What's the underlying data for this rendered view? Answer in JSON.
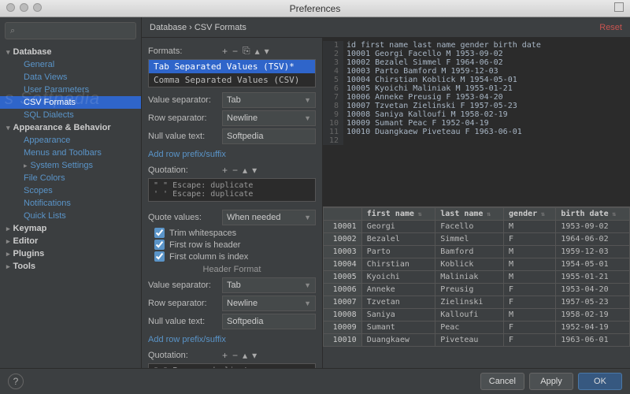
{
  "window": {
    "title": "Preferences"
  },
  "sidebar": {
    "search_placeholder": "",
    "groups": [
      {
        "label": "Database",
        "children": [
          "General",
          "Data Views",
          "User Parameters",
          "CSV Formats",
          "SQL Dialects"
        ],
        "expanded": true,
        "selected_index": 3
      },
      {
        "label": "Appearance & Behavior",
        "children": [
          "Appearance",
          "Menus and Toolbars",
          "System Settings",
          "File Colors",
          "Scopes",
          "Notifications",
          "Quick Lists"
        ],
        "expanded": true,
        "sub_caret": 2
      },
      {
        "label": "Keymap"
      },
      {
        "label": "Editor"
      },
      {
        "label": "Plugins"
      },
      {
        "label": "Tools"
      }
    ]
  },
  "watermark": "s      Softpedia",
  "breadcrumb": {
    "path": "Database › CSV Formats",
    "reset": "Reset"
  },
  "formats": {
    "label": "Formats:",
    "items": [
      "Tab Separated Values (TSV)*",
      "Comma Separated Values (CSV)"
    ],
    "selected": 0
  },
  "settings": {
    "value_separator": {
      "label": "Value separator:",
      "value": "Tab"
    },
    "row_separator": {
      "label": "Row separator:",
      "value": "Newline"
    },
    "null_text": {
      "label": "Null value text:",
      "value": "Softpedia"
    },
    "add_prefix_link": "Add row prefix/suffix",
    "quotation_label": "Quotation:",
    "quotation_rows": [
      "\"   \"   Escape: duplicate",
      "'   '   Escape: duplicate"
    ],
    "quote_values": {
      "label": "Quote values:",
      "value": "When needed"
    },
    "trim": {
      "label": "Trim whitespaces",
      "checked": true
    },
    "first_row": {
      "label": "First row is header",
      "checked": true
    },
    "first_col": {
      "label": "First column is index",
      "checked": true
    },
    "header_format": "Header Format",
    "h_val_sep": {
      "label": "Value separator:",
      "value": "Tab"
    },
    "h_row_sep": {
      "label": "Row separator:",
      "value": "Newline"
    },
    "h_null": {
      "label": "Null value text:",
      "value": "Softpedia"
    },
    "h_prefix_link": "Add row prefix/suffix",
    "h_quotation_label": "Quotation:",
    "h_quotation_rows": [
      "\"   \"   Escape: duplicate"
    ]
  },
  "chart_data": {
    "type": "table",
    "columns": [
      "id",
      "first name",
      "last name",
      "gender",
      "birth date"
    ],
    "rows": [
      [
        "10001",
        "Georgi",
        "Facello",
        "M",
        "1953-09-02"
      ],
      [
        "10002",
        "Bezalel",
        "Simmel",
        "F",
        "1964-06-02"
      ],
      [
        "10003",
        "Parto",
        "Bamford",
        "M",
        "1959-12-03"
      ],
      [
        "10004",
        "Chirstian",
        "Koblick",
        "M",
        "1954-05-01"
      ],
      [
        "10005",
        "Kyoichi",
        "Maliniak",
        "M",
        "1955-01-21"
      ],
      [
        "10006",
        "Anneke",
        "Preusig",
        "F",
        "1953-04-20"
      ],
      [
        "10007",
        "Tzvetan",
        "Zielinski",
        "F",
        "1957-05-23"
      ],
      [
        "10008",
        "Saniya",
        "Kalloufi",
        "M",
        "1958-02-19"
      ],
      [
        "10009",
        "Sumant",
        "Peac",
        "F",
        "1952-04-19"
      ],
      [
        "10010",
        "Duangkaew",
        "Piveteau",
        "F",
        "1963-06-01"
      ]
    ]
  },
  "buttons": {
    "help": "?",
    "cancel": "Cancel",
    "apply": "Apply",
    "ok": "OK"
  }
}
